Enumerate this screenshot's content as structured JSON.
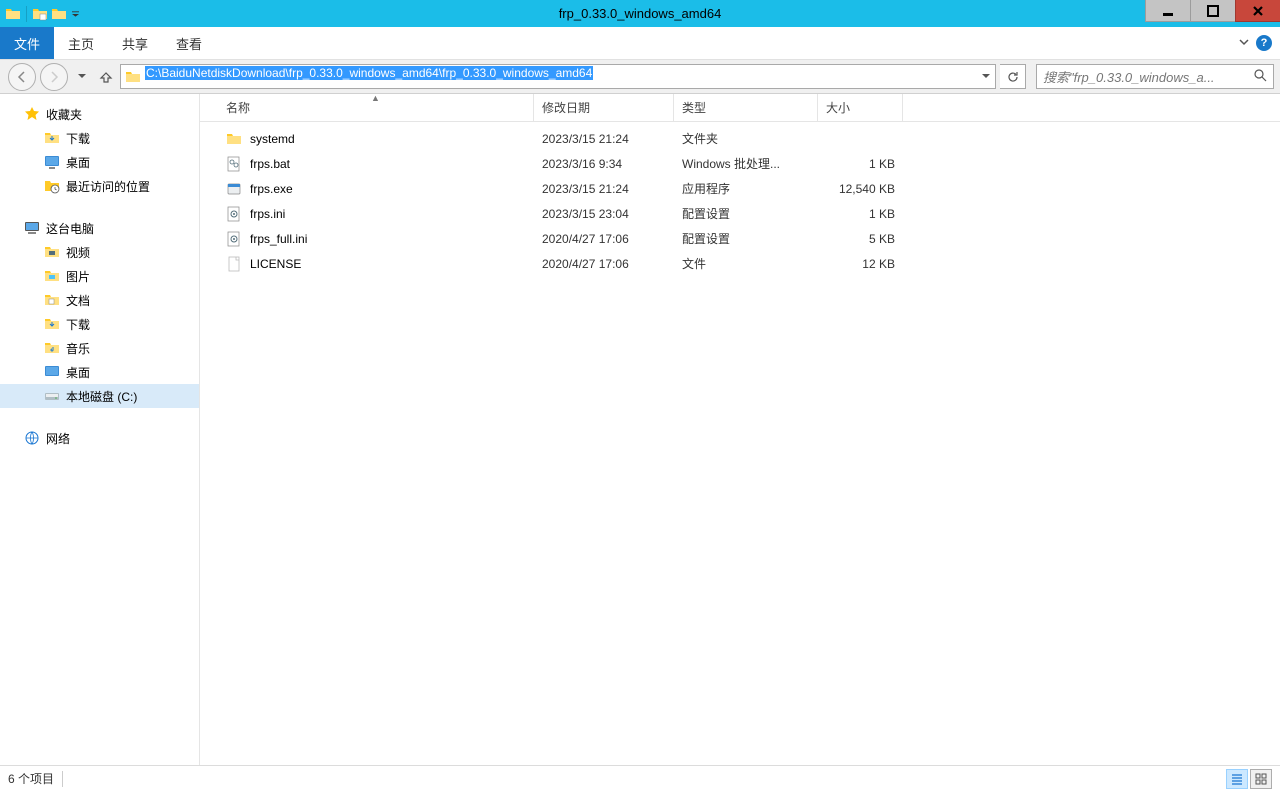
{
  "window": {
    "title": "frp_0.33.0_windows_amd64"
  },
  "ribbon": {
    "file": "文件",
    "home": "主页",
    "share": "共享",
    "view": "查看"
  },
  "address": {
    "path": "C:\\BaiduNetdiskDownload\\frp_0.33.0_windows_amd64\\frp_0.33.0_windows_amd64"
  },
  "search": {
    "placeholder": "搜索\"frp_0.33.0_windows_a..."
  },
  "sidebar": {
    "favorites": "收藏夹",
    "downloads": "下载",
    "desktop": "桌面",
    "recent": "最近访问的位置",
    "thispc": "这台电脑",
    "videos": "视频",
    "pictures": "图片",
    "documents": "文档",
    "downloads2": "下载",
    "music": "音乐",
    "desktop2": "桌面",
    "localdisk": "本地磁盘 (C:)",
    "network": "网络"
  },
  "columns": {
    "name": "名称",
    "date": "修改日期",
    "type": "类型",
    "size": "大小"
  },
  "files": [
    {
      "icon": "folder",
      "name": "systemd",
      "date": "2023/3/15 21:24",
      "type": "文件夹",
      "size": ""
    },
    {
      "icon": "bat",
      "name": "frps.bat",
      "date": "2023/3/16 9:34",
      "type": "Windows 批处理...",
      "size": "1 KB"
    },
    {
      "icon": "exe",
      "name": "frps.exe",
      "date": "2023/3/15 21:24",
      "type": "应用程序",
      "size": "12,540 KB"
    },
    {
      "icon": "ini",
      "name": "frps.ini",
      "date": "2023/3/15 23:04",
      "type": "配置设置",
      "size": "1 KB"
    },
    {
      "icon": "ini",
      "name": "frps_full.ini",
      "date": "2020/4/27 17:06",
      "type": "配置设置",
      "size": "5 KB"
    },
    {
      "icon": "file",
      "name": "LICENSE",
      "date": "2020/4/27 17:06",
      "type": "文件",
      "size": "12 KB"
    }
  ],
  "status": {
    "count": "6 个项目"
  }
}
